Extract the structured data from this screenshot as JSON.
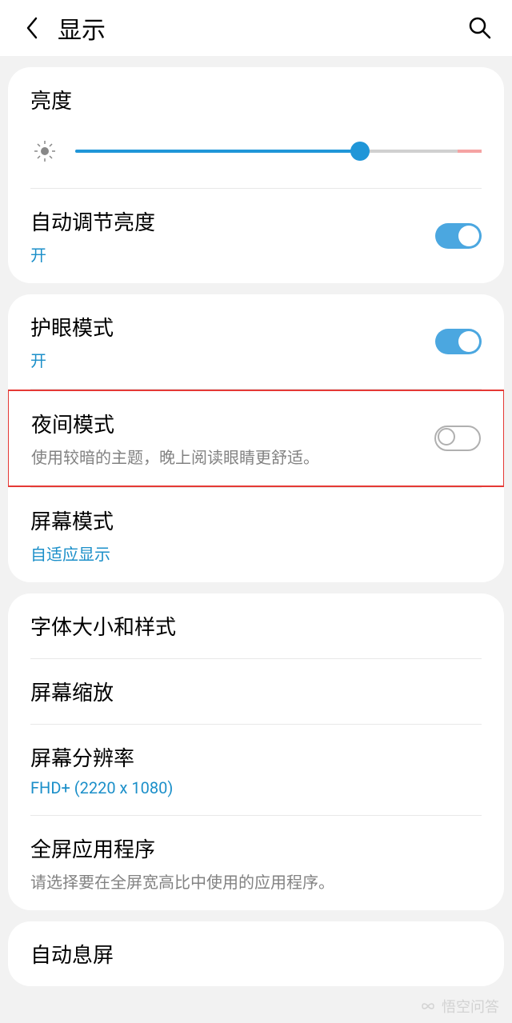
{
  "header": {
    "title": "显示"
  },
  "brightness": {
    "label": "亮度",
    "value_percent": 70
  },
  "auto_brightness": {
    "title": "自动调节亮度",
    "status": "开",
    "on": true
  },
  "eye_comfort": {
    "title": "护眼模式",
    "status": "开",
    "on": true
  },
  "night_mode": {
    "title": "夜间模式",
    "desc": "使用较暗的主题，晚上阅读眼睛更舒适。",
    "on": false
  },
  "screen_mode": {
    "title": "屏幕模式",
    "value": "自适应显示"
  },
  "font": {
    "title": "字体大小和样式"
  },
  "zoom": {
    "title": "屏幕缩放"
  },
  "resolution": {
    "title": "屏幕分辨率",
    "value": "FHD+ (2220 x 1080)"
  },
  "fullscreen_apps": {
    "title": "全屏应用程序",
    "desc": "请选择要在全屏宽高比中使用的应用程序。"
  },
  "auto_sleep": {
    "title": "自动息屏"
  },
  "watermark": "悟空问答"
}
